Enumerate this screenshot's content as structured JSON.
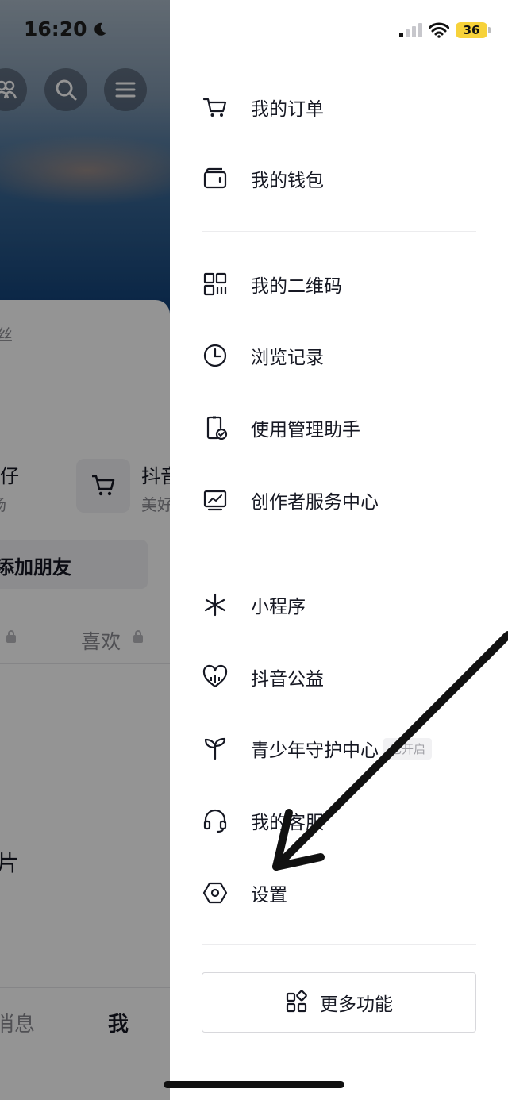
{
  "status_bar": {
    "time": "16:20",
    "battery": "36"
  },
  "background": {
    "fans_fragment": "丝",
    "left_item_title": "仔仔",
    "left_item_sub": "场",
    "right_item_title": "抖音",
    "right_item_sub": "美好",
    "add_friend": "添加朋友",
    "likes_tab": "喜欢",
    "section_fragment": "片",
    "nav_messages": "消息",
    "nav_me": "我"
  },
  "drawer": {
    "groups": [
      [
        {
          "label": "我的订单",
          "icon": "cart-icon"
        },
        {
          "label": "我的钱包",
          "icon": "wallet-icon"
        }
      ],
      [
        {
          "label": "我的二维码",
          "icon": "qrcode-icon"
        },
        {
          "label": "浏览记录",
          "icon": "clock-icon"
        },
        {
          "label": "使用管理助手",
          "icon": "phone-check-icon"
        },
        {
          "label": "创作者服务中心",
          "icon": "monitor-chart-icon"
        }
      ],
      [
        {
          "label": "小程序",
          "icon": "mini-program-icon"
        },
        {
          "label": "抖音公益",
          "icon": "heart-charity-icon"
        },
        {
          "label": "青少年守护中心",
          "icon": "sprout-icon",
          "badge": "已开启"
        },
        {
          "label": "我的客服",
          "icon": "headset-icon"
        },
        {
          "label": "设置",
          "icon": "hexagon-settings-icon"
        }
      ]
    ],
    "more_button": "更多功能"
  }
}
